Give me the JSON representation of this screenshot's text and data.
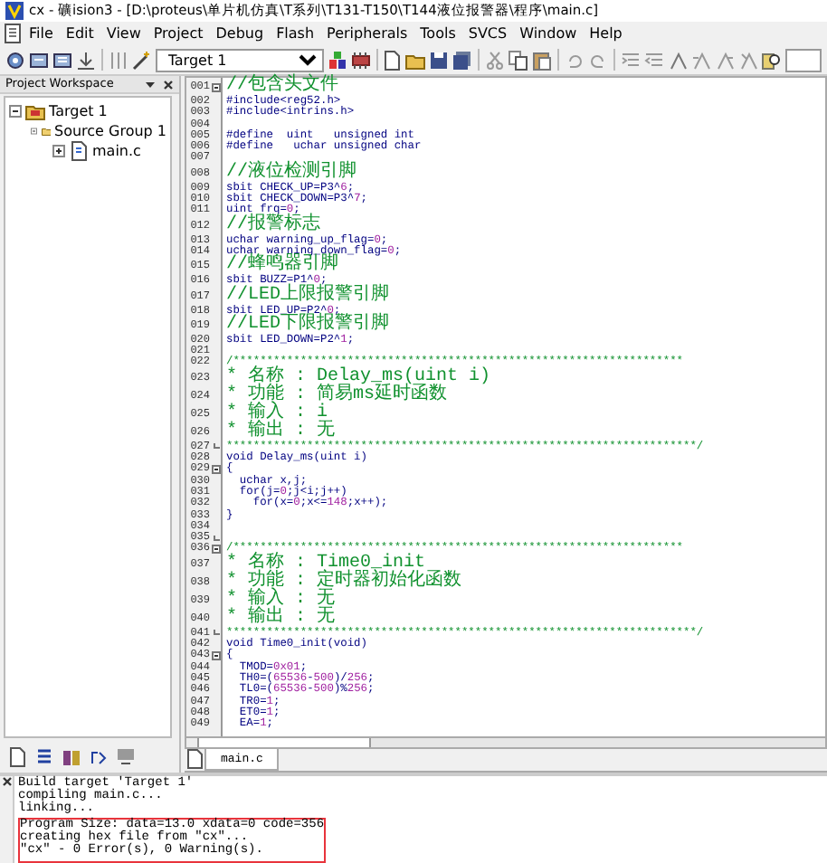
{
  "window": {
    "title": "cx - 礦ision3 - [D:\\proteus\\单片机仿真\\T系列\\T131-T150\\T144液位报警器\\程序\\main.c]"
  },
  "menu": [
    "File",
    "Edit",
    "View",
    "Project",
    "Debug",
    "Flash",
    "Peripherals",
    "Tools",
    "SVCS",
    "Window",
    "Help"
  ],
  "toolbar": {
    "target": "Target 1"
  },
  "workspace": {
    "title": "Project Workspace",
    "tree": [
      {
        "label": "Target 1",
        "kind": "target",
        "expanded": true,
        "children": [
          {
            "label": "Source Group 1",
            "kind": "group",
            "expanded": true,
            "children": [
              {
                "label": "main.c",
                "kind": "file",
                "expanded": false
              }
            ]
          }
        ]
      }
    ]
  },
  "editor": {
    "tabs": [
      {
        "label": "main.c",
        "selected": true
      }
    ],
    "lines": [
      {
        "number": "001",
        "fold_start": true,
        "segments": [
          {
            "kind": "comment",
            "text": "//包含头文件"
          }
        ]
      },
      {
        "number": "002",
        "segments": [
          {
            "kind": "code",
            "text": "#include<reg52.h>"
          }
        ]
      },
      {
        "number": "003",
        "segments": [
          {
            "kind": "code",
            "text": "#include<intrins.h>"
          }
        ]
      },
      {
        "number": "004"
      },
      {
        "number": "005",
        "segments": [
          {
            "kind": "code",
            "text": "#define  uint   unsigned int"
          }
        ]
      },
      {
        "number": "006",
        "segments": [
          {
            "kind": "code",
            "text": "#define   uchar unsigned char"
          }
        ]
      },
      {
        "number": "007"
      },
      {
        "number": "008",
        "segments": [
          {
            "kind": "comment",
            "text": "//液位检测引脚"
          }
        ]
      },
      {
        "number": "009",
        "segments": [
          {
            "kind": "code",
            "text": "sbit CHECK_UP=P3^"
          },
          {
            "kind": "number",
            "text": "6"
          },
          {
            "kind": "code",
            "text": ";"
          }
        ]
      },
      {
        "number": "010",
        "segments": [
          {
            "kind": "code",
            "text": "sbit CHECK_DOWN=P3^"
          },
          {
            "kind": "number",
            "text": "7"
          },
          {
            "kind": "code",
            "text": ";"
          }
        ]
      },
      {
        "number": "011",
        "segments": [
          {
            "kind": "code",
            "text": "uint frq="
          },
          {
            "kind": "number",
            "text": "0"
          },
          {
            "kind": "code",
            "text": ";"
          }
        ]
      },
      {
        "number": "012",
        "segments": [
          {
            "kind": "comment",
            "text": "//报警标志"
          }
        ]
      },
      {
        "number": "013",
        "segments": [
          {
            "kind": "code",
            "text": "uchar warning_up_flag="
          },
          {
            "kind": "number",
            "text": "0"
          },
          {
            "kind": "code",
            "text": ";"
          }
        ]
      },
      {
        "number": "014",
        "segments": [
          {
            "kind": "code",
            "text": "uchar warning_down_flag="
          },
          {
            "kind": "number",
            "text": "0"
          },
          {
            "kind": "code",
            "text": ";"
          }
        ]
      },
      {
        "number": "015",
        "segments": [
          {
            "kind": "comment",
            "text": "//蜂鸣器引脚"
          }
        ]
      },
      {
        "number": "016",
        "segments": [
          {
            "kind": "code",
            "text": "sbit BUZZ=P1^"
          },
          {
            "kind": "number",
            "text": "0"
          },
          {
            "kind": "code",
            "text": ";"
          }
        ]
      },
      {
        "number": "017",
        "segments": [
          {
            "kind": "comment",
            "text": "//LED上限报警引脚"
          }
        ]
      },
      {
        "number": "018",
        "segments": [
          {
            "kind": "code",
            "text": "sbit LED_UP=P2^"
          },
          {
            "kind": "number",
            "text": "0"
          },
          {
            "kind": "code",
            "text": ";"
          }
        ]
      },
      {
        "number": "019",
        "segments": [
          {
            "kind": "comment",
            "text": "//LED下限报警引脚"
          }
        ]
      },
      {
        "number": "020",
        "segments": [
          {
            "kind": "code",
            "text": "sbit LED_DOWN=P2^"
          },
          {
            "kind": "number",
            "text": "1"
          },
          {
            "kind": "code",
            "text": ";"
          }
        ]
      },
      {
        "number": "021"
      },
      {
        "number": "022",
        "segments": [
          {
            "kind": "comment",
            "text": "/*******************************************************************"
          }
        ]
      },
      {
        "number": "023",
        "segments": [
          {
            "kind": "comment",
            "text": "* 名称 : Delay_ms(uint i)"
          }
        ]
      },
      {
        "number": "024",
        "segments": [
          {
            "kind": "comment",
            "text": "* 功能 : 简易ms延时函数"
          }
        ]
      },
      {
        "number": "025",
        "segments": [
          {
            "kind": "comment",
            "text": "* 输入 : i"
          }
        ]
      },
      {
        "number": "026",
        "segments": [
          {
            "kind": "comment",
            "text": "* 输出 : 无"
          }
        ]
      },
      {
        "number": "027",
        "fold_end": true,
        "segments": [
          {
            "kind": "comment",
            "text": "**********************************************************************/"
          }
        ]
      },
      {
        "number": "028",
        "segments": [
          {
            "kind": "code",
            "text": "void Delay_ms(uint i)"
          }
        ]
      },
      {
        "number": "029",
        "fold_start": true,
        "segments": [
          {
            "kind": "code",
            "text": "{"
          }
        ]
      },
      {
        "number": "030",
        "segments": [
          {
            "kind": "code",
            "text": "  uchar x,j;"
          }
        ]
      },
      {
        "number": "031",
        "segments": [
          {
            "kind": "code",
            "text": "  for(j="
          },
          {
            "kind": "number",
            "text": "0"
          },
          {
            "kind": "code",
            "text": ";j<i;j++)"
          }
        ]
      },
      {
        "number": "032",
        "segments": [
          {
            "kind": "code",
            "text": "    for(x="
          },
          {
            "kind": "number",
            "text": "0"
          },
          {
            "kind": "code",
            "text": ";x<="
          },
          {
            "kind": "number",
            "text": "148"
          },
          {
            "kind": "code",
            "text": ";x++);"
          }
        ]
      },
      {
        "number": "033",
        "segments": [
          {
            "kind": "code",
            "text": "}"
          }
        ]
      },
      {
        "number": "034"
      },
      {
        "number": "035",
        "fold_end": true
      },
      {
        "number": "036",
        "fold_start": true,
        "segments": [
          {
            "kind": "comment",
            "text": "/*******************************************************************"
          }
        ]
      },
      {
        "number": "037",
        "segments": [
          {
            "kind": "comment",
            "text": "* 名称 : Time0_init"
          }
        ]
      },
      {
        "number": "038",
        "segments": [
          {
            "kind": "comment",
            "text": "* 功能 : 定时器初始化函数"
          }
        ]
      },
      {
        "number": "039",
        "segments": [
          {
            "kind": "comment",
            "text": "* 输入 : 无"
          }
        ]
      },
      {
        "number": "040",
        "segments": [
          {
            "kind": "comment",
            "text": "* 输出 : 无"
          }
        ]
      },
      {
        "number": "041",
        "fold_end": true,
        "segments": [
          {
            "kind": "comment",
            "text": "**********************************************************************/"
          }
        ]
      },
      {
        "number": "042",
        "segments": [
          {
            "kind": "code",
            "text": "void Time0_init(void)"
          }
        ]
      },
      {
        "number": "043",
        "fold_start": true,
        "segments": [
          {
            "kind": "code",
            "text": "{"
          }
        ]
      },
      {
        "number": "044",
        "segments": [
          {
            "kind": "code",
            "text": "  TMOD="
          },
          {
            "kind": "number",
            "text": "0x01"
          },
          {
            "kind": "code",
            "text": ";"
          }
        ]
      },
      {
        "number": "045",
        "segments": [
          {
            "kind": "code",
            "text": "  TH0=("
          },
          {
            "kind": "number",
            "text": "65536"
          },
          {
            "kind": "code",
            "text": "-"
          },
          {
            "kind": "number",
            "text": "500"
          },
          {
            "kind": "code",
            "text": ")/"
          },
          {
            "kind": "number",
            "text": "256"
          },
          {
            "kind": "code",
            "text": ";"
          }
        ]
      },
      {
        "number": "046",
        "segments": [
          {
            "kind": "code",
            "text": "  TL0=("
          },
          {
            "kind": "number",
            "text": "65536"
          },
          {
            "kind": "code",
            "text": "-"
          },
          {
            "kind": "number",
            "text": "500"
          },
          {
            "kind": "code",
            "text": ")%"
          },
          {
            "kind": "number",
            "text": "256"
          },
          {
            "kind": "code",
            "text": ";"
          }
        ]
      },
      {
        "number": "047",
        "segments": [
          {
            "kind": "code",
            "text": "  TR0="
          },
          {
            "kind": "number",
            "text": "1"
          },
          {
            "kind": "code",
            "text": ";"
          }
        ]
      },
      {
        "number": "048",
        "segments": [
          {
            "kind": "code",
            "text": "  ET0="
          },
          {
            "kind": "number",
            "text": "1"
          },
          {
            "kind": "code",
            "text": ";"
          }
        ]
      },
      {
        "number": "049",
        "segments": [
          {
            "kind": "code",
            "text": "  EA="
          },
          {
            "kind": "number",
            "text": "1"
          },
          {
            "kind": "code",
            "text": ";"
          }
        ]
      }
    ]
  },
  "output": {
    "lines": [
      {
        "text": "Build target 'Target 1'",
        "boxed": false
      },
      {
        "text": "compiling main.c...",
        "boxed": false
      },
      {
        "text": "linking...",
        "boxed": false
      },
      {
        "text": "Program Size: data=13.0 xdata=0 code=356",
        "boxed": true
      },
      {
        "text": "creating hex file from \"cx\"...",
        "boxed": true
      },
      {
        "text": "\"cx\" - 0 Error(s), 0 Warning(s).",
        "boxed": true
      }
    ]
  }
}
